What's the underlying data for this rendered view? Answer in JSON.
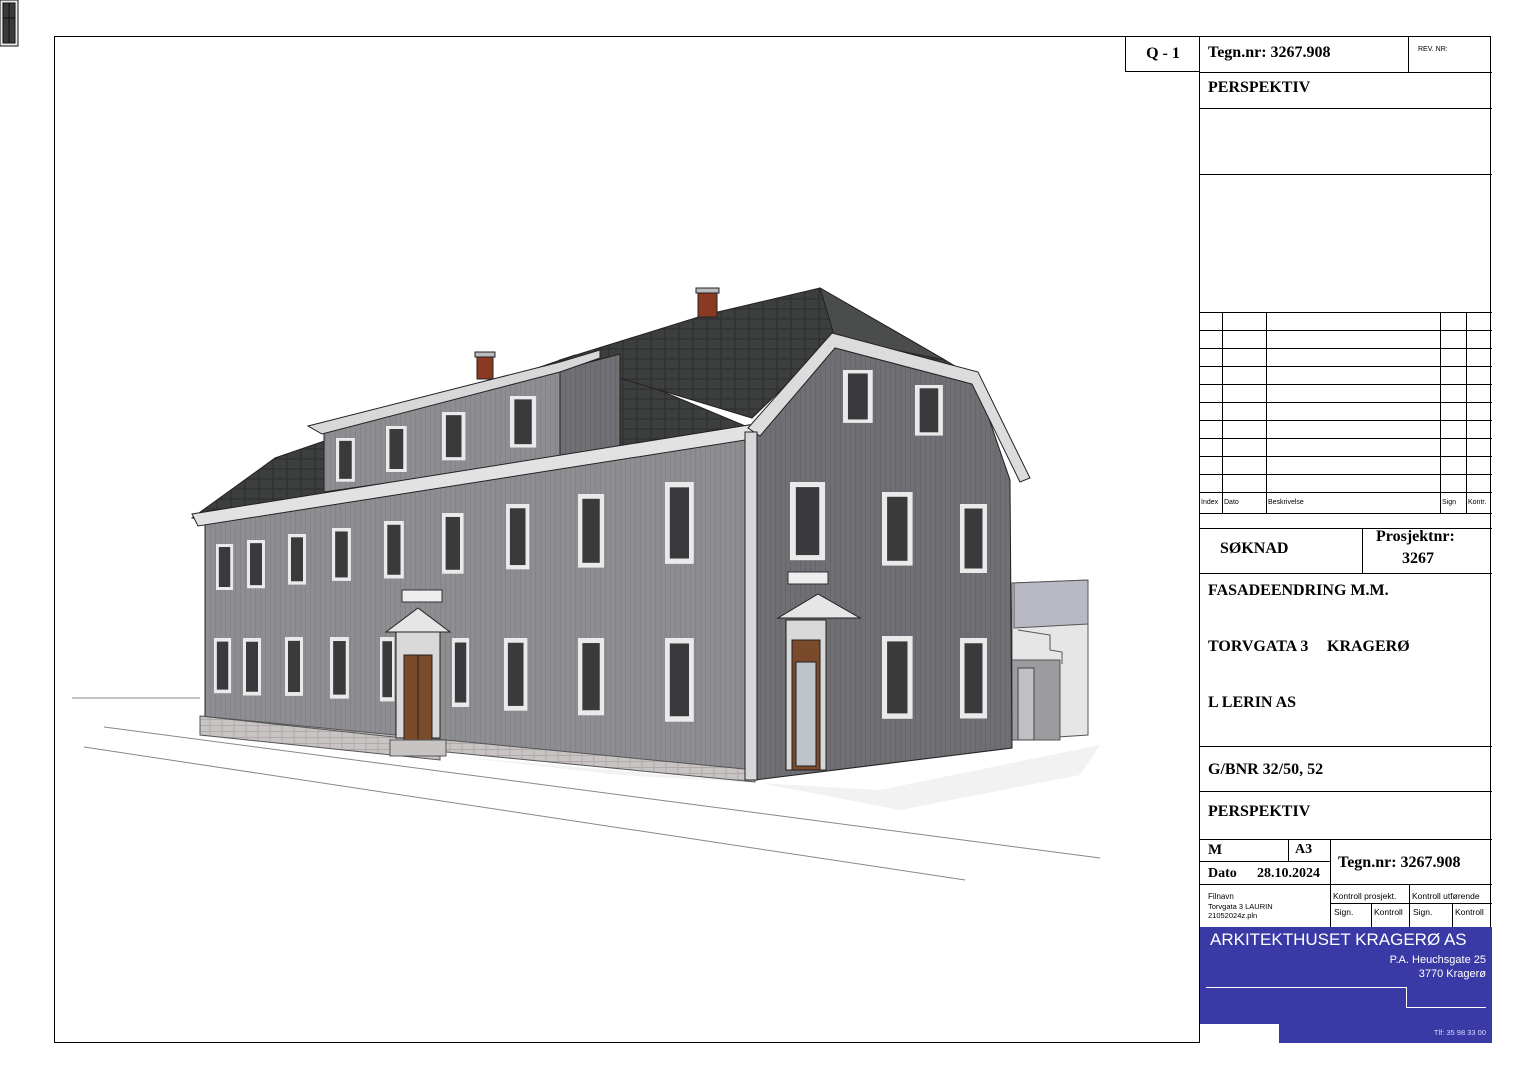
{
  "sheet": {
    "sheet_code": "Q - 1",
    "drawing_no": "Tegn.nr: 3267.908",
    "rev_label": "REV. NR:",
    "view_title_top": "PERSPEKTIV"
  },
  "revision_table": {
    "headers": [
      "Index",
      "Dato",
      "Beskrivelse",
      "Sign",
      "Kontr."
    ]
  },
  "project": {
    "application": "SØKNAD",
    "project_no_label": "Prosjektnr:",
    "project_no": "3267",
    "description": "FASADEENDRING  M.M.",
    "address": "TORVGATA 3",
    "town": "KRAGERØ",
    "client": "L LERIN AS",
    "gbnr": "G/BNR  32/50, 52",
    "view_title": "PERSPEKTIV"
  },
  "meta": {
    "scale_label": "M",
    "paper": "A3",
    "date_label": "Dato",
    "date": "28.10.2024",
    "drawing_no": "Tegn.nr: 3267.908",
    "filename_label": "Filnavn",
    "filename_line1": "Torvgata 3  LAURIN",
    "filename_line2": "21052024z.pln",
    "control_project": "Kontroll prosjekt.",
    "control_executing": "Kontroll utførende",
    "sign1": "Sign.",
    "kontroll1": "Kontroll",
    "sign2": "Sign.",
    "kontroll2": "Kontroll"
  },
  "company": {
    "name": "ARKITEKTHUSET KRAGERØ AS",
    "street": "P.A. Heuchsgate 25",
    "city": "3770 Kragerø",
    "phone": "Tlf: 35 98 33 00",
    "color": "#3a3aa6"
  }
}
